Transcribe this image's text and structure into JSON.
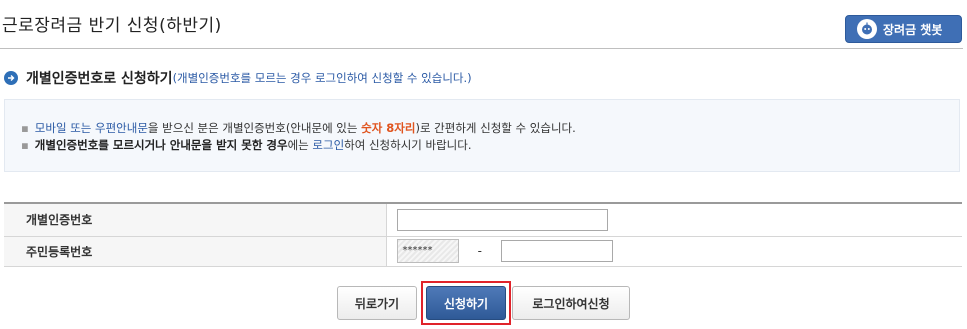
{
  "page": {
    "title": "근로장려금 반기 신청(하반기)",
    "chatbot_label": "장려금 챗봇"
  },
  "section": {
    "heading": "개별인증번호로 신청하기",
    "subheading": "(개별인증번호를 모르는 경우 로그인하여 신청할 수 있습니다.)"
  },
  "notice": {
    "line1": {
      "link": "모바일 또는 우편안내문",
      "text1": "을 받으신 분은 개별인증번호(안내문에 있는 ",
      "highlight": "숫자 8자리",
      "text2": ")로 간편하게 신청할 수 있습니다."
    },
    "line2": {
      "strong": "개별인증번호를 모르시거나 안내문을 받지 못한 경우",
      "text1": "에는 ",
      "link": "로그인",
      "text2": "하여 신청하시기 바랍니다."
    }
  },
  "form": {
    "auth_label": "개별인증번호",
    "auth_value": "",
    "rrn_label": "주민등록번호",
    "rrn_front_masked": "******",
    "rrn_dash": "-",
    "rrn_back_value": ""
  },
  "buttons": {
    "back": "뒤로가기",
    "apply": "신청하기",
    "login_apply": "로그인하여신청"
  },
  "colors": {
    "primary_blue": "#3f6fb5",
    "highlight_orange": "#e0541e",
    "focus_red": "#e0232a"
  }
}
